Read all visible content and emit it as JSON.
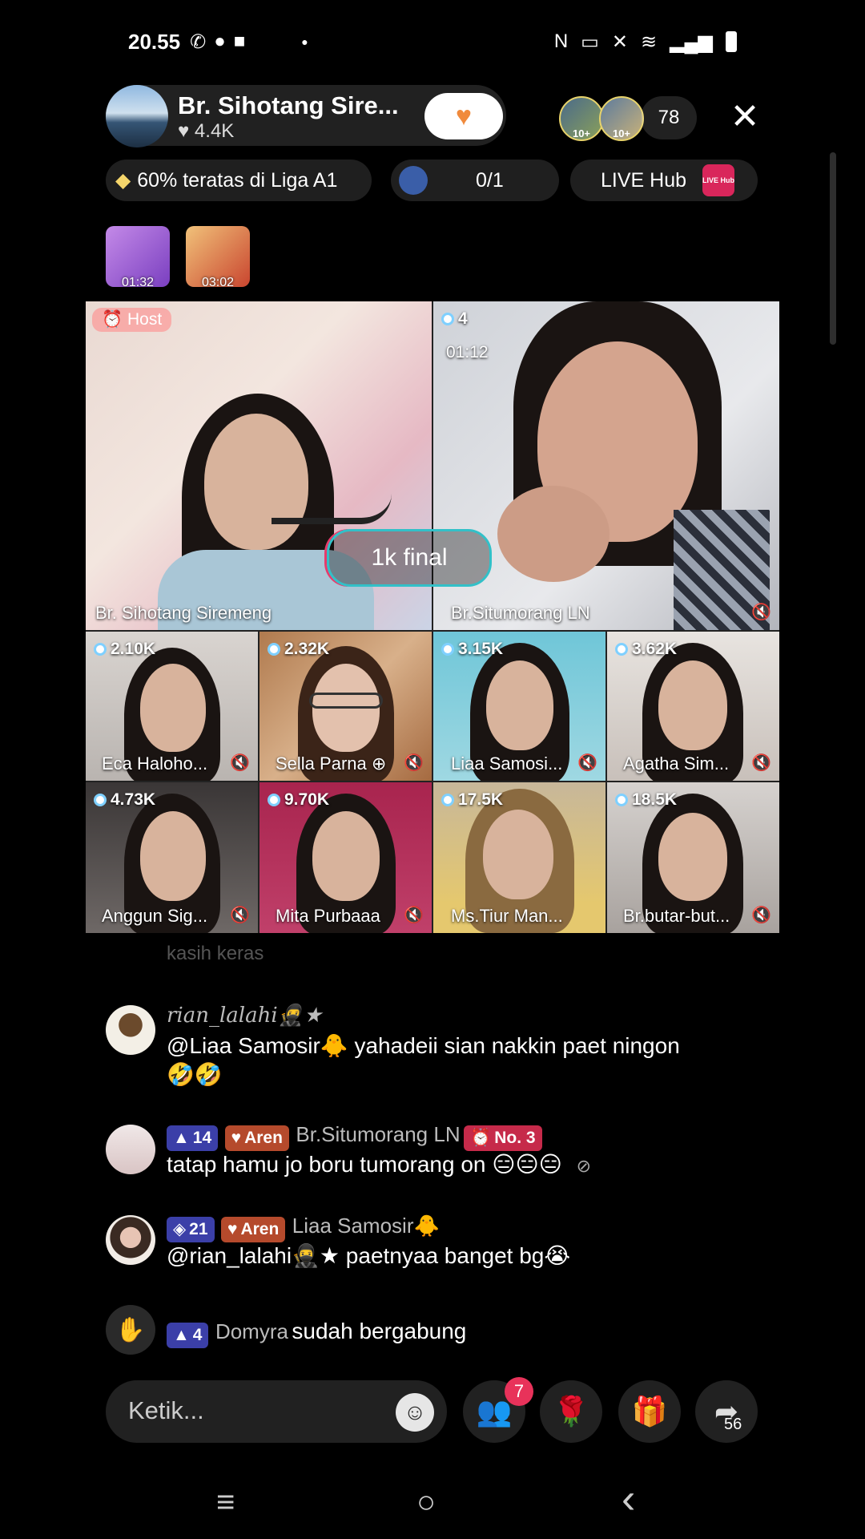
{
  "status_bar": {
    "time": "20.55",
    "icons_left": [
      "whatsapp-icon",
      "chat-icon",
      "video-icon",
      "dot-icon"
    ],
    "icons_right": [
      "nfc-icon",
      "cast-icon",
      "mute-icon",
      "wifi-icon",
      "signal-icon",
      "battery-icon"
    ]
  },
  "header": {
    "host_name": "Br. Sihotang Sire...",
    "likes": "4.4K",
    "follow_icon": "heart-icon",
    "viewer_badges": [
      "10+",
      "10+"
    ],
    "viewer_count": "78",
    "close_icon": "close-icon"
  },
  "info_row": {
    "league": "60% teratas di Liga A1",
    "goal": "0/1",
    "hub": "LIVE Hub",
    "hub_badge": "LIVE Hub"
  },
  "treasure": [
    {
      "timer": "01:32",
      "color": "#9b57d6"
    },
    {
      "timer": "03:02",
      "color": "#d9534a"
    }
  ],
  "grid": {
    "host_tag": "Host",
    "final_label": "1k final",
    "main": [
      {
        "name": "Br. Sihotang Siremeng",
        "count": ""
      },
      {
        "name": "Br.Situmorang LN",
        "count": "4",
        "timer": "01:12"
      }
    ],
    "small": [
      {
        "name": "Eca Haloho...",
        "count": "2.10K"
      },
      {
        "name": "Sella Parna",
        "count": "2.32K"
      },
      {
        "name": "Liaa Samosi...",
        "count": "3.15K"
      },
      {
        "name": "Agatha Sim...",
        "count": "3.62K"
      },
      {
        "name": "Anggun Sig...",
        "count": "4.73K"
      },
      {
        "name": "Mita Purbaaa",
        "count": "9.70K"
      },
      {
        "name": "Ms.Tiur Man...",
        "count": "17.5K"
      },
      {
        "name": "Br.butar-but...",
        "count": "18.5K"
      }
    ]
  },
  "chat": {
    "faded": "kasih keras",
    "messages": [
      {
        "user": "rian_lalahi🥷★",
        "text": "@Liaa Samosir🐥 yahadeii sian nakkin paet ningon",
        "text2": "🤣🤣"
      },
      {
        "level": "14",
        "fanclub": "Aren",
        "user": "Br.Situmorang LN",
        "rank": "No. 3",
        "text": "tatap hamu jo boru tumorang on 😑😑😑"
      },
      {
        "level": "21",
        "fanclub": "Aren",
        "user": "Liaa Samosir🐥",
        "text": "@rian_lalahi🥷★ paetnyaa banget bg😭"
      },
      {
        "level": "4",
        "user": "Domyra",
        "text": "sudah bergabung"
      }
    ]
  },
  "bottom_bar": {
    "placeholder": "Ketik...",
    "notif_count": "7",
    "share_count": "56"
  },
  "nav_bar": {
    "recent": "≡",
    "home": "○",
    "back": "‹"
  }
}
